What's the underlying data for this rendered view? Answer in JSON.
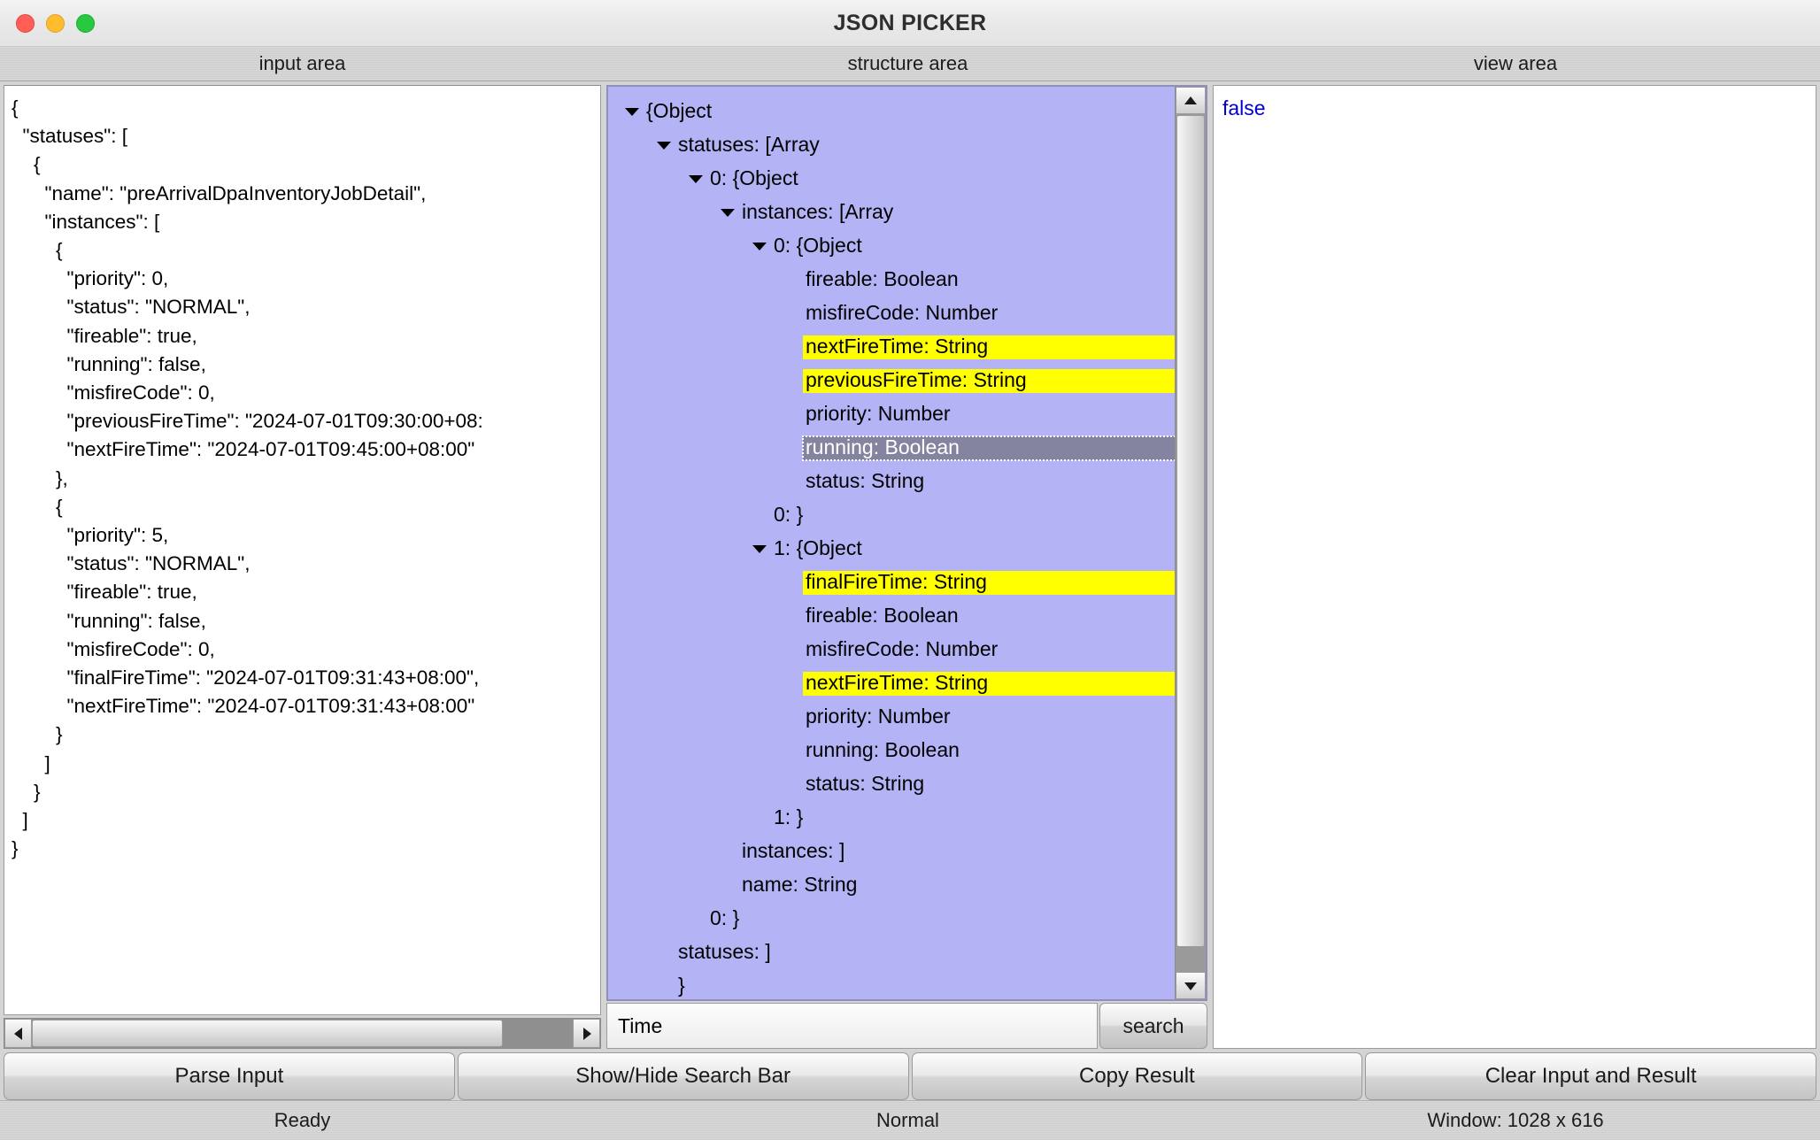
{
  "window": {
    "title": "JSON PICKER",
    "traffic_lights": [
      "close-button",
      "minimize-button",
      "maximize-button"
    ]
  },
  "headers": {
    "input": "input area",
    "structure": "structure area",
    "view": "view area"
  },
  "input_area": {
    "content": "{\n  \"statuses\": [\n    {\n      \"name\": \"preArrivalDpaInventoryJobDetail\",\n      \"instances\": [\n        {\n          \"priority\": 0,\n          \"status\": \"NORMAL\",\n          \"fireable\": true,\n          \"running\": false,\n          \"misfireCode\": 0,\n          \"previousFireTime\": \"2024-07-01T09:30:00+08:\n          \"nextFireTime\": \"2024-07-01T09:45:00+08:00\"\n        },\n        {\n          \"priority\": 5,\n          \"status\": \"NORMAL\",\n          \"fireable\": true,\n          \"running\": false,\n          \"misfireCode\": 0,\n          \"finalFireTime\": \"2024-07-01T09:31:43+08:00\",\n          \"nextFireTime\": \"2024-07-01T09:31:43+08:00\"\n        }\n      ]\n    }\n  ]\n}"
  },
  "structure_area": {
    "rows": [
      {
        "label": "{Object",
        "indent": 0,
        "twist": "down",
        "state": "normal"
      },
      {
        "label": "statuses: [Array",
        "indent": 1,
        "twist": "down",
        "state": "normal"
      },
      {
        "label": "0: {Object",
        "indent": 2,
        "twist": "down",
        "state": "normal"
      },
      {
        "label": "instances: [Array",
        "indent": 3,
        "twist": "down",
        "state": "normal"
      },
      {
        "label": "0: {Object",
        "indent": 4,
        "twist": "down",
        "state": "normal"
      },
      {
        "label": "fireable: Boolean",
        "indent": 5,
        "twist": "none",
        "state": "normal"
      },
      {
        "label": "misfireCode: Number",
        "indent": 5,
        "twist": "none",
        "state": "normal"
      },
      {
        "label": "nextFireTime: String",
        "indent": 5,
        "twist": "none",
        "state": "highlight"
      },
      {
        "label": "previousFireTime: String",
        "indent": 5,
        "twist": "none",
        "state": "highlight"
      },
      {
        "label": "priority: Number",
        "indent": 5,
        "twist": "none",
        "state": "normal"
      },
      {
        "label": "running: Boolean",
        "indent": 5,
        "twist": "none",
        "state": "selected"
      },
      {
        "label": "status: String",
        "indent": 5,
        "twist": "none",
        "state": "normal"
      },
      {
        "label": "0: }",
        "indent": 4,
        "twist": "none",
        "state": "normal"
      },
      {
        "label": "1: {Object",
        "indent": 4,
        "twist": "down",
        "state": "normal"
      },
      {
        "label": "finalFireTime: String",
        "indent": 5,
        "twist": "none",
        "state": "highlight"
      },
      {
        "label": "fireable: Boolean",
        "indent": 5,
        "twist": "none",
        "state": "normal"
      },
      {
        "label": "misfireCode: Number",
        "indent": 5,
        "twist": "none",
        "state": "normal"
      },
      {
        "label": "nextFireTime: String",
        "indent": 5,
        "twist": "none",
        "state": "highlight"
      },
      {
        "label": "priority: Number",
        "indent": 5,
        "twist": "none",
        "state": "normal"
      },
      {
        "label": "running: Boolean",
        "indent": 5,
        "twist": "none",
        "state": "normal"
      },
      {
        "label": "status: String",
        "indent": 5,
        "twist": "none",
        "state": "normal"
      },
      {
        "label": "1: }",
        "indent": 4,
        "twist": "none",
        "state": "normal"
      },
      {
        "label": "instances: ]",
        "indent": 3,
        "twist": "none",
        "state": "normal"
      },
      {
        "label": "name: String",
        "indent": 3,
        "twist": "none",
        "state": "normal"
      },
      {
        "label": "0: }",
        "indent": 2,
        "twist": "none",
        "state": "normal"
      },
      {
        "label": "statuses: ]",
        "indent": 1,
        "twist": "none",
        "state": "normal"
      },
      {
        "label": "}",
        "indent": 1,
        "twist": "none",
        "state": "normal"
      }
    ]
  },
  "search": {
    "value": "Time",
    "button_label": "search"
  },
  "view_area": {
    "content": "false"
  },
  "buttons": {
    "parse_input": "Parse Input",
    "show_hide_search_bar": "Show/Hide Search Bar",
    "copy_result": "Copy Result",
    "clear_input_and_result": "Clear Input and Result"
  },
  "status": {
    "left": "Ready",
    "middle": "Normal",
    "right": "Window: 1028 x 616"
  },
  "colors": {
    "tree_background": "#b3b3f5",
    "highlight": "#ffff00",
    "selection": "#8484a0",
    "view_text": "#0000cc"
  }
}
